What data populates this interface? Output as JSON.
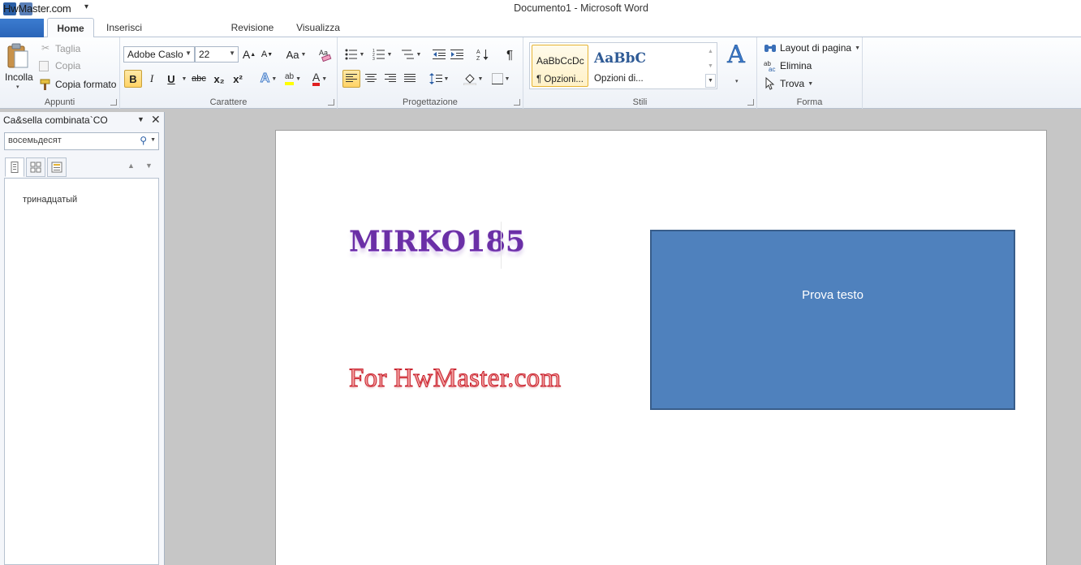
{
  "titlebar": {
    "watermark": "HwMaster.com",
    "title": "Documento1  -  Microsoft Word"
  },
  "tabs": [
    {
      "label": "Home"
    },
    {
      "label": "Inserisci"
    },
    {
      "label": "Revisione"
    },
    {
      "label": "Visualizza"
    }
  ],
  "ribbon": {
    "clipboard": {
      "paste": "Incolla",
      "cut": "Taglia",
      "copy": "Copia",
      "format_painter": "Copia formato",
      "group_label": "Appunti"
    },
    "font": {
      "font_name": "Adobe Caslo",
      "font_size": "22",
      "group_label": "Carattere",
      "grow": "A",
      "shrink": "A",
      "case": "Aa",
      "bold": "B",
      "italic": "I",
      "underline": "U",
      "strike": "abc",
      "subscript": "x₂",
      "superscript": "x²"
    },
    "paragraph": {
      "group_label": "Progettazione",
      "pilcrow": "¶"
    },
    "styles": {
      "group_label": "Stili",
      "items": [
        {
          "sample": "AaBbCcDc",
          "name": "¶ Opzioni..."
        },
        {
          "sample": "AaBbC",
          "name": "Opzioni di..."
        }
      ],
      "change_styles": "A"
    },
    "editing": {
      "group_label": "Forma",
      "layout": "Layout di pagina",
      "delete": "Elimina",
      "find": "Trova"
    }
  },
  "navpane": {
    "title": "Ca&sella combinata`CO",
    "search_value": "восемьдесят",
    "result": "тринадцатый"
  },
  "document": {
    "wordart1": "MIRKO185",
    "wordart2": "For HwMaster.com",
    "textbox_text": "Prova testo"
  },
  "colors": {
    "textbox_fill": "#4f81bd",
    "wordart1": "#6a2fa6",
    "wordart2_outline": "#c81e2a",
    "file_tab": "#2a65b8"
  }
}
